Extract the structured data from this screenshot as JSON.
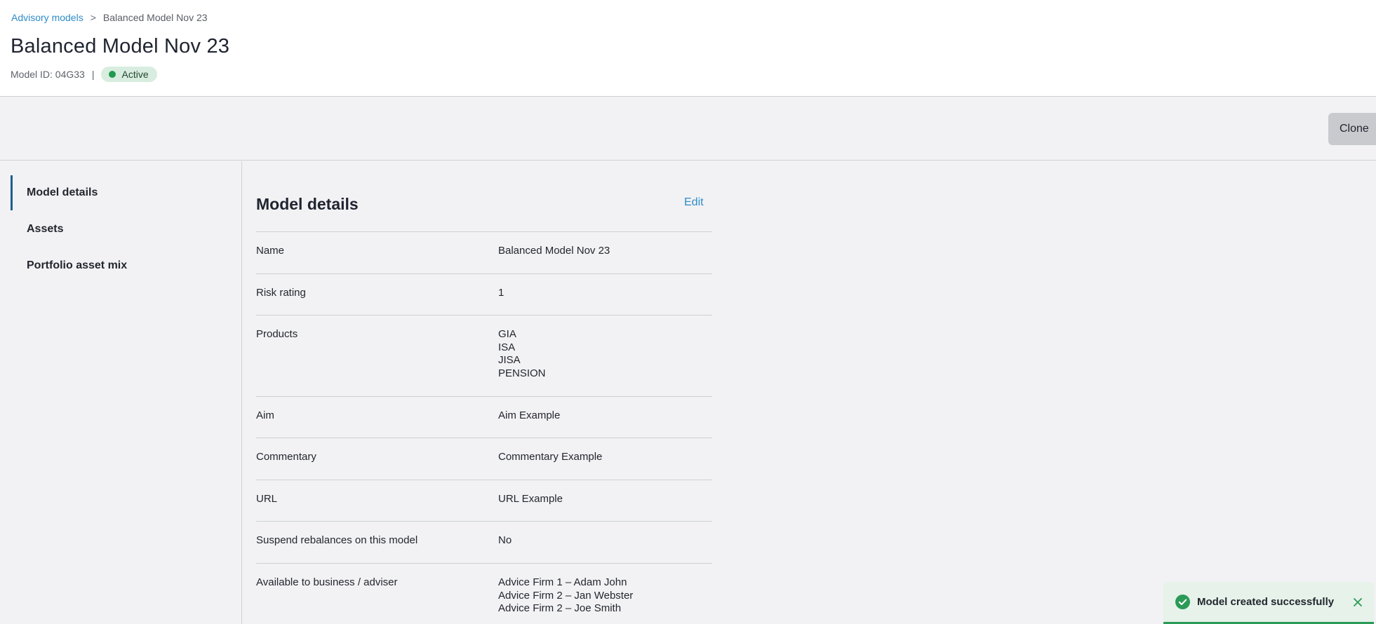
{
  "breadcrumb": {
    "parent": "Advisory models",
    "separator": ">",
    "current": "Balanced Model Nov 23"
  },
  "header": {
    "title": "Balanced Model Nov 23",
    "model_id": "Model ID: 04G33",
    "separator": "|",
    "status": "Active"
  },
  "toolbar": {
    "clone_label": "Clone"
  },
  "sidebar": {
    "items": [
      {
        "label": "Model details",
        "active": true
      },
      {
        "label": "Assets",
        "active": false
      },
      {
        "label": "Portfolio asset mix",
        "active": false
      }
    ]
  },
  "details": {
    "title": "Model details",
    "edit_label": "Edit",
    "rows": [
      {
        "label": "Name",
        "values": [
          "Balanced Model Nov 23"
        ]
      },
      {
        "label": "Risk rating",
        "values": [
          "1"
        ]
      },
      {
        "label": "Products",
        "values": [
          "GIA",
          "ISA",
          "JISA",
          "PENSION"
        ]
      },
      {
        "label": "Aim",
        "values": [
          "Aim Example"
        ]
      },
      {
        "label": "Commentary",
        "values": [
          "Commentary Example"
        ]
      },
      {
        "label": "URL",
        "values": [
          "URL Example"
        ]
      },
      {
        "label": "Suspend rebalances on this model",
        "values": [
          "No"
        ]
      },
      {
        "label": "Available to business / adviser",
        "values": [
          "Advice Firm 1 – Adam John",
          "Advice Firm 2 – Jan Webster",
          "Advice Firm 2 – Joe Smith"
        ]
      }
    ]
  },
  "toast": {
    "message": "Model created successfully"
  },
  "colors": {
    "link": "#2f8cc8",
    "active_nav": "#1c5f8f",
    "status_green": "#1f9a4e",
    "toast_green": "#2a9a56"
  },
  "icons": {
    "toast": "check-circle-icon",
    "close": "close-icon",
    "status": "status-dot-icon"
  }
}
